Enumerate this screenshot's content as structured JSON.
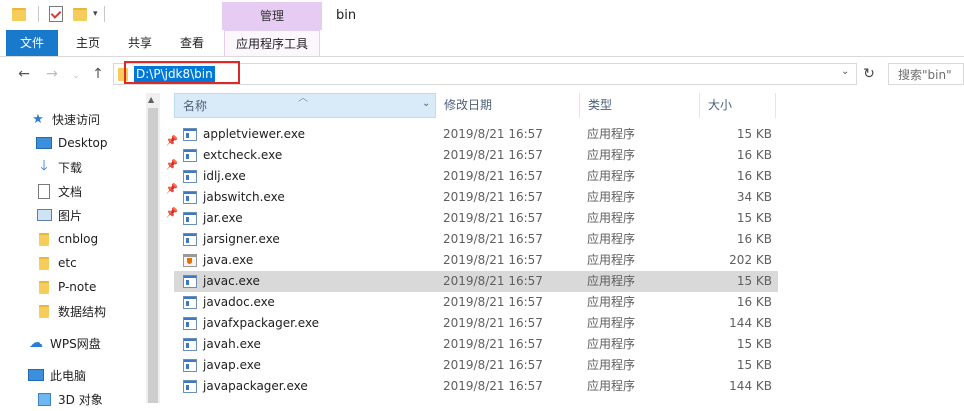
{
  "titlebar": {
    "context_tab": "管理",
    "window_title": "bin"
  },
  "ribbon": {
    "tabs": [
      "文件",
      "主页",
      "共享",
      "查看",
      "应用程序工具"
    ]
  },
  "address": {
    "path": "D:\\P\\jdk8\\bin",
    "search_placeholder": "搜索\"bin\""
  },
  "sidebar": {
    "items": [
      {
        "label": "快速访问",
        "icon": "star-icon"
      },
      {
        "label": "Desktop",
        "icon": "desktop-icon",
        "pinned": true
      },
      {
        "label": "下载",
        "icon": "download-icon",
        "pinned": true
      },
      {
        "label": "文档",
        "icon": "document-icon",
        "pinned": true
      },
      {
        "label": "图片",
        "icon": "picture-icon",
        "pinned": true
      },
      {
        "label": "cnblog",
        "icon": "folder-icon"
      },
      {
        "label": "etc",
        "icon": "folder-icon"
      },
      {
        "label": "P-note",
        "icon": "folder-icon"
      },
      {
        "label": "数据结构",
        "icon": "folder-icon"
      },
      {
        "label": "WPS网盘",
        "icon": "cloud-icon"
      },
      {
        "label": "此电脑",
        "icon": "computer-icon"
      },
      {
        "label": "3D 对象",
        "icon": "cube-icon"
      }
    ]
  },
  "columns": {
    "name": "名称",
    "date": "修改日期",
    "type": "类型",
    "size": "大小"
  },
  "files": [
    {
      "name": "appletviewer.exe",
      "date": "2019/8/21 16:57",
      "type": "应用程序",
      "size": "15 KB",
      "icon": "exe-icon"
    },
    {
      "name": "extcheck.exe",
      "date": "2019/8/21 16:57",
      "type": "应用程序",
      "size": "16 KB",
      "icon": "exe-icon"
    },
    {
      "name": "idlj.exe",
      "date": "2019/8/21 16:57",
      "type": "应用程序",
      "size": "16 KB",
      "icon": "exe-icon"
    },
    {
      "name": "jabswitch.exe",
      "date": "2019/8/21 16:57",
      "type": "应用程序",
      "size": "34 KB",
      "icon": "exe-icon"
    },
    {
      "name": "jar.exe",
      "date": "2019/8/21 16:57",
      "type": "应用程序",
      "size": "15 KB",
      "icon": "exe-icon"
    },
    {
      "name": "jarsigner.exe",
      "date": "2019/8/21 16:57",
      "type": "应用程序",
      "size": "16 KB",
      "icon": "exe-icon"
    },
    {
      "name": "java.exe",
      "date": "2019/8/21 16:57",
      "type": "应用程序",
      "size": "202 KB",
      "icon": "java-icon"
    },
    {
      "name": "javac.exe",
      "date": "2019/8/21 16:57",
      "type": "应用程序",
      "size": "15 KB",
      "icon": "exe-icon",
      "selected": true
    },
    {
      "name": "javadoc.exe",
      "date": "2019/8/21 16:57",
      "type": "应用程序",
      "size": "16 KB",
      "icon": "exe-icon"
    },
    {
      "name": "javafxpackager.exe",
      "date": "2019/8/21 16:57",
      "type": "应用程序",
      "size": "144 KB",
      "icon": "exe-icon"
    },
    {
      "name": "javah.exe",
      "date": "2019/8/21 16:57",
      "type": "应用程序",
      "size": "15 KB",
      "icon": "exe-icon"
    },
    {
      "name": "javap.exe",
      "date": "2019/8/21 16:57",
      "type": "应用程序",
      "size": "15 KB",
      "icon": "exe-icon"
    },
    {
      "name": "javapackager.exe",
      "date": "2019/8/21 16:57",
      "type": "应用程序",
      "size": "144 KB",
      "icon": "exe-icon"
    }
  ]
}
